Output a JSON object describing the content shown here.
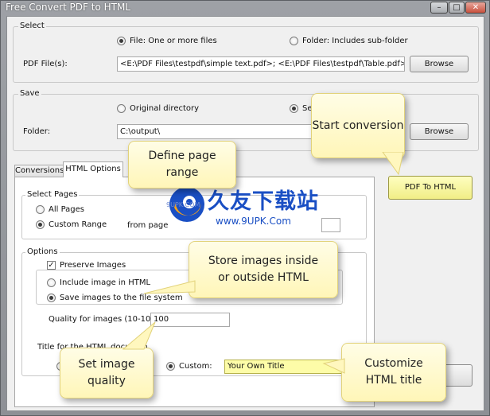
{
  "window": {
    "title": "Free Convert PDF to HTML",
    "controls": {
      "minimize": "–",
      "maximize": "□",
      "close": "✕"
    }
  },
  "select": {
    "label": "Select",
    "file_option": "File:  One or more files",
    "folder_option": "Folder: Includes sub-folder",
    "pdf_files_label": "PDF File(s):",
    "pdf_files_value": "<E:\\PDF Files\\testpdf\\simple text.pdf>; <E:\\PDF Files\\testpdf\\Table.pdf>; <E:\\PDF",
    "browse": "Browse"
  },
  "save": {
    "label": "Save",
    "original_option": "Original directory",
    "selected_option": "Sel",
    "folder_label": "Folder:",
    "folder_value": "C:\\output\\",
    "browse": "Browse"
  },
  "tabs": [
    {
      "label": "Conversions"
    },
    {
      "label": "HTML Options"
    }
  ],
  "convert_button": "PDF To HTML",
  "select_pages": {
    "label": "Select Pages",
    "all_pages": "All Pages",
    "custom_range": "Custom Range",
    "from_page": "from page"
  },
  "options": {
    "label": "Options",
    "preserve_images": "Preserve Images",
    "include_in_html": "Include image in HTML",
    "save_to_fs": "Save images to the file system",
    "quality_label": "Quality for images (10-100):",
    "quality_value": "100",
    "title_label": "Title for the HTML documen",
    "custom_label": "Custom:",
    "custom_title": "Your Own Title"
  },
  "callouts": {
    "start_conversion": "Start conversion",
    "define_page_line1": "Define page",
    "define_page_line2": "range",
    "store_images_line1": "Store images inside",
    "store_images_line2": "or outside HTML",
    "image_quality_line1": "Set image",
    "image_quality_line2": "quality",
    "customize_title_line1": "Customize",
    "customize_title_line2": "HTML title"
  },
  "watermark": {
    "brand_cn": "久友下载站",
    "url": "www.9UPK.Com",
    "url_small": "9UPK.COM"
  },
  "colors": {
    "convert_button_bg": "#fdfca8",
    "callout_bg": "#fff8c4",
    "watermark_blue": "#1a4fc4",
    "watermark_orange": "#f3a21b"
  }
}
